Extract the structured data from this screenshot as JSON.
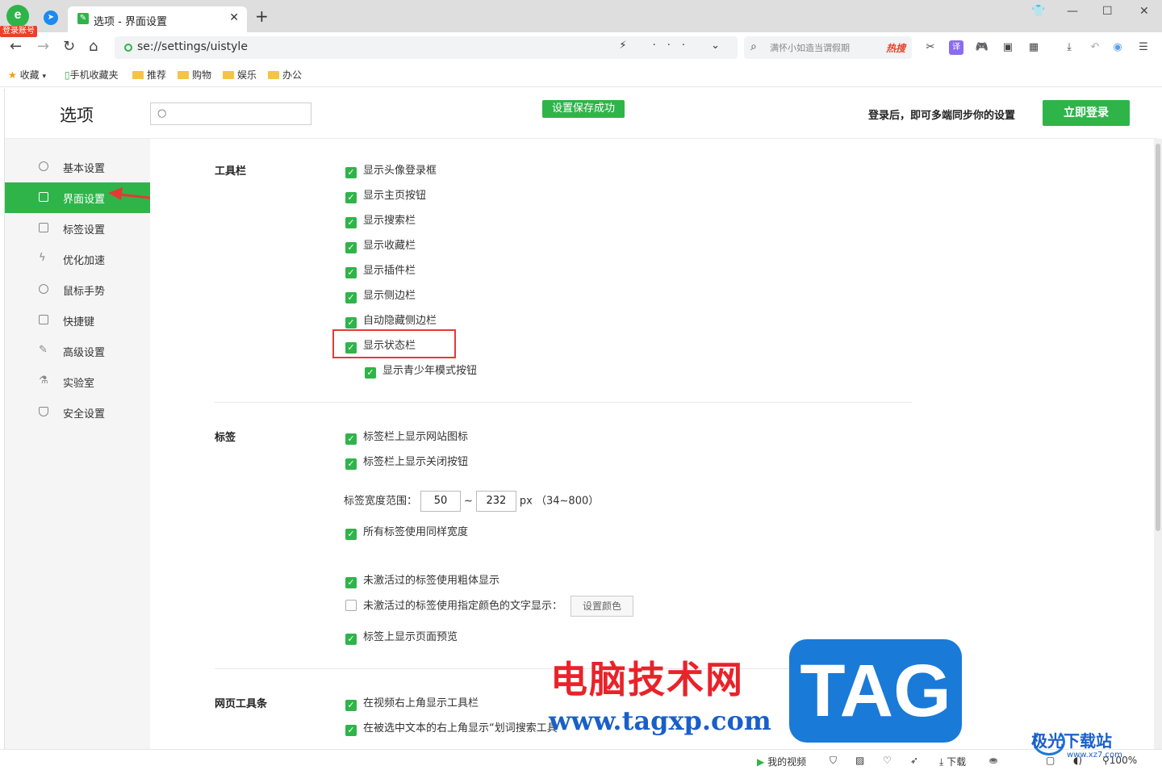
{
  "browser": {
    "login_badge": "登录账号",
    "tab_title": "选项 - 界面设置",
    "url": "se://settings/uistyle",
    "search_placeholder": "满怀小如造当谓假期",
    "hot_label": "热搜"
  },
  "bookmarks": [
    "收藏",
    "手机收藏夹",
    "推荐",
    "购物",
    "娱乐",
    "办公"
  ],
  "header": {
    "title": "选项",
    "save_toast": "设置保存成功",
    "sync_text": "登录后，即可多端同步你的设置",
    "login_button": "立即登录"
  },
  "sidebar": {
    "items": [
      {
        "label": "基本设置"
      },
      {
        "label": "界面设置"
      },
      {
        "label": "标签设置"
      },
      {
        "label": "优化加速"
      },
      {
        "label": "鼠标手势"
      },
      {
        "label": "快捷键"
      },
      {
        "label": "高级设置"
      },
      {
        "label": "实验室"
      },
      {
        "label": "安全设置"
      }
    ],
    "active": "界面设置"
  },
  "sections": {
    "toolbar": {
      "title": "工具栏",
      "options": [
        {
          "label": "显示头像登录框",
          "checked": true
        },
        {
          "label": "显示主页按钮",
          "checked": true
        },
        {
          "label": "显示搜索栏",
          "checked": true
        },
        {
          "label": "显示收藏栏",
          "checked": true
        },
        {
          "label": "显示插件栏",
          "checked": true
        },
        {
          "label": "显示侧边栏",
          "checked": true
        },
        {
          "label": "自动隐藏侧边栏",
          "checked": true
        },
        {
          "label": "显示状态栏",
          "checked": true
        },
        {
          "label": "显示青少年模式按钮",
          "checked": true
        }
      ]
    },
    "tabs": {
      "title": "标签",
      "options": [
        {
          "label": "标签栏上显示网站图标",
          "checked": true
        },
        {
          "label": "标签栏上显示关闭按钮",
          "checked": true
        },
        {
          "label": "所有标签使用同样宽度",
          "checked": true
        },
        {
          "label": "未激活过的标签使用粗体显示",
          "checked": true
        },
        {
          "label": "未激活过的标签使用指定颜色的文字显示：",
          "checked": false
        },
        {
          "label": "标签上显示页面预览",
          "checked": true
        }
      ],
      "width_label": "标签宽度范围：",
      "width_min": "50",
      "width_sep": "~",
      "width_max": "232",
      "width_unit": "px （34~800）",
      "color_button": "设置颜色"
    },
    "webbar": {
      "title": "网页工具条",
      "options": [
        {
          "label": "在视频右上角显示工具栏",
          "checked": true
        },
        {
          "label": "在被选中文本的右上角显示“划词搜索工具",
          "checked": true
        }
      ]
    }
  },
  "statusbar": {
    "my_video": "我的视频",
    "download": "下载",
    "zoom": "100%"
  },
  "watermark": {
    "text": "电脑技术网",
    "url": "www.tagxp.com",
    "tag": "TAG",
    "site": "极光下载站",
    "site_url": "www.xz7.com"
  },
  "colors": {
    "accent": "#2fb44a",
    "highlight": "#e53935"
  }
}
